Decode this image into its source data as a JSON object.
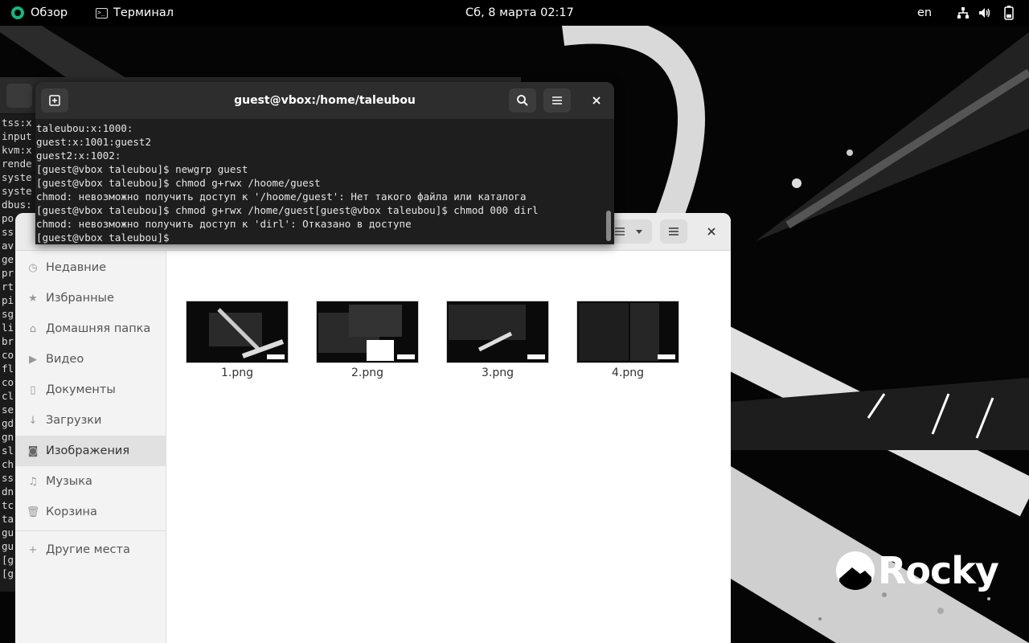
{
  "topbar": {
    "activities_label": "Обзор",
    "app_menu_label": "Терминал",
    "clock": "Сб, 8 марта  02:17",
    "language": "en"
  },
  "terminal": {
    "title": "guest@vbox:/home/taleubou",
    "lines": [
      "taleubou:x:1000:",
      "guest:x:1001:guest2",
      "guest2:x:1002:",
      "[guest@vbox taleubou]$ newgrp guest",
      "[guest@vbox taleubou]$ chmod g+rwx /hoome/guest",
      "chmod: невозможно получить доступ к '/hoome/guest': Нет такого файла или каталога",
      "[guest@vbox taleubou]$ chmod g+rwx /home/guest[guest@vbox taleubou]$ chmod 000 dirl",
      "chmod: невозможно получить доступ к 'dirl': Отказано в доступе",
      "[guest@vbox taleubou]$ "
    ]
  },
  "bg_terminal": {
    "lines": [
      "tss:x",
      "input",
      "kvm:x",
      "rende",
      "syste",
      "syste",
      "dbus:",
      "po",
      "ss",
      "av",
      "ge",
      "pr",
      "rt",
      "pi",
      "sg",
      "li",
      "br",
      "co",
      "fl",
      "co",
      "cl",
      "se",
      "gd",
      "gn",
      "sl",
      "ch",
      "ss",
      "dn",
      "tc",
      "ta",
      "gu",
      "gu",
      "[g",
      "[g"
    ]
  },
  "files": {
    "sidebar": [
      {
        "label": "Недавние",
        "icon": "clock-icon"
      },
      {
        "label": "Избранные",
        "icon": "star-icon"
      },
      {
        "label": "Домашняя папка",
        "icon": "home-icon"
      },
      {
        "label": "Видео",
        "icon": "video-icon"
      },
      {
        "label": "Документы",
        "icon": "document-icon"
      },
      {
        "label": "Загрузки",
        "icon": "download-icon"
      },
      {
        "label": "Изображения",
        "icon": "camera-icon",
        "active": true
      },
      {
        "label": "Музыка",
        "icon": "music-icon"
      },
      {
        "label": "Корзина",
        "icon": "trash-icon"
      }
    ],
    "other_places": "Другие места",
    "items": [
      {
        "name": "1.png"
      },
      {
        "name": "2.png"
      },
      {
        "name": "3.png"
      },
      {
        "name": "4.png"
      }
    ]
  },
  "logo": {
    "text": "Rocky"
  }
}
